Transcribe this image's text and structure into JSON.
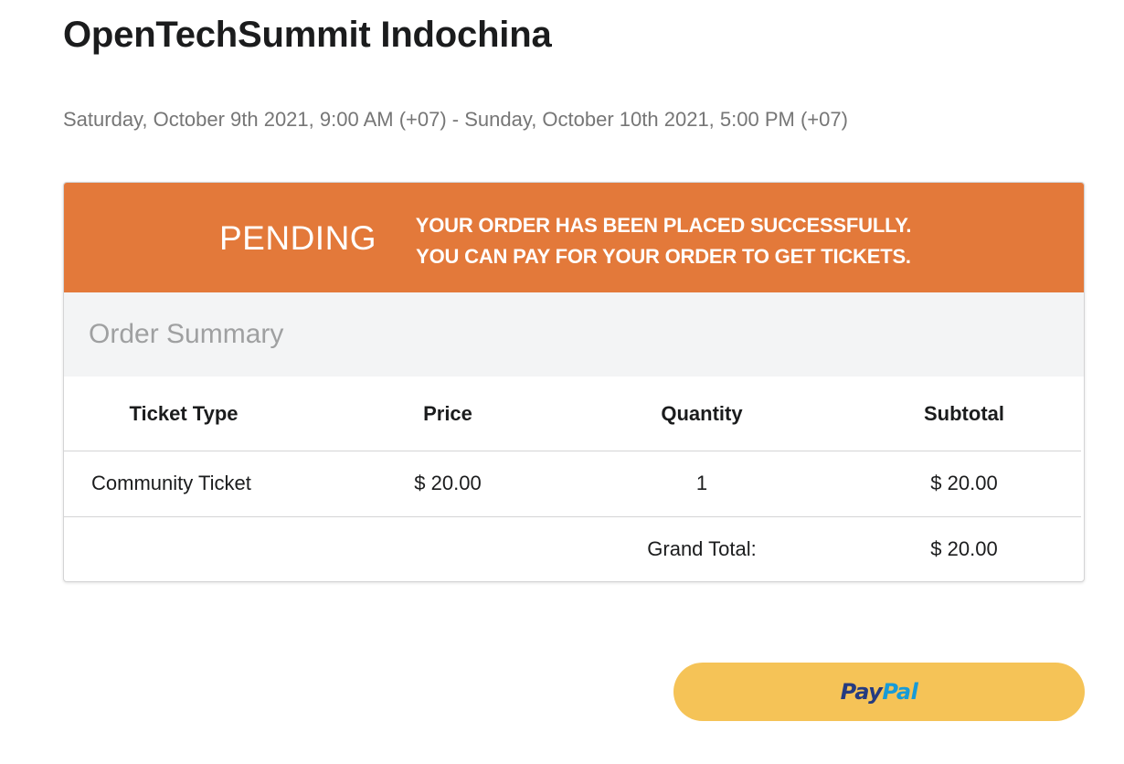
{
  "event": {
    "title": "OpenTechSummit Indochina",
    "dates": "Saturday, October 9th 2021, 9:00 AM (+07) - Sunday, October 10th 2021, 5:00 PM (+07)"
  },
  "status": {
    "label": "PENDING",
    "message_line1": "YOUR ORDER HAS BEEN PLACED SUCCESSFULLY.",
    "message_line2": "YOU CAN PAY FOR YOUR ORDER TO GET TICKETS.",
    "color": "#e3793a"
  },
  "order_summary": {
    "title": "Order Summary",
    "columns": [
      "Ticket Type",
      "Price",
      "Quantity",
      "Subtotal"
    ],
    "rows": [
      {
        "ticket_type": "Community Ticket",
        "price": "$ 20.00",
        "quantity": "1",
        "subtotal": "$ 20.00"
      }
    ],
    "grand_total_label": "Grand Total:",
    "grand_total_value": "$ 20.00"
  },
  "payment": {
    "button_text_dark": "Pay",
    "button_text_light": "Pal",
    "button_color": "#f5c357",
    "icon": "paypal-logo"
  }
}
